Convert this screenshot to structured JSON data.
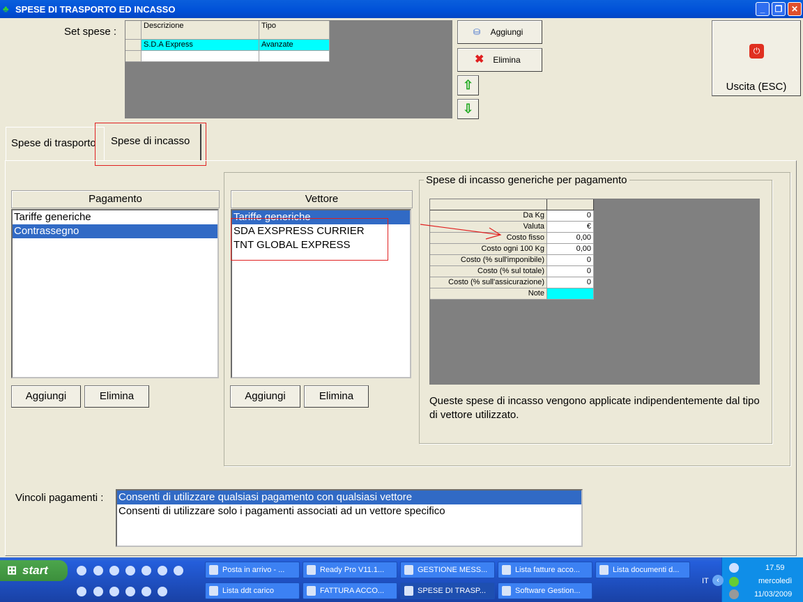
{
  "window": {
    "title": "SPESE DI TRASPORTO ED INCASSO",
    "minimize": "_",
    "restore": "❐",
    "close": "✕"
  },
  "set_spese": {
    "label": "Set spese :",
    "columns": [
      "Descrizione",
      "Tipo"
    ],
    "rows": [
      {
        "descrizione": "S.D.A Express",
        "tipo": "Avanzate"
      }
    ]
  },
  "toolbar": {
    "add": "Aggiungi",
    "delete": "Elimina",
    "up": "⇧",
    "down": "⇩",
    "exit": "Uscita (ESC)"
  },
  "tabs": [
    {
      "label": "Spese di trasporto"
    },
    {
      "label": "Spese di incasso"
    }
  ],
  "pagamento": {
    "header": "Pagamento",
    "items": [
      "Tariffe generiche",
      "Contrassegno"
    ],
    "selected": 1,
    "add": "Aggiungi",
    "delete": "Elimina"
  },
  "vettore": {
    "header": "Vettore",
    "items": [
      "Tariffe generiche",
      "SDA EXSPRESS CURRIER",
      "TNT GLOBAL EXPRESS"
    ],
    "selected": 0,
    "add": "Aggiungi",
    "delete": "Elimina"
  },
  "generiche": {
    "title": "Spese di incasso generiche per pagamento",
    "rows": [
      {
        "label": "Da Kg",
        "value": "0"
      },
      {
        "label": "Valuta",
        "value": "€"
      },
      {
        "label": "Costo fisso",
        "value": "0,00"
      },
      {
        "label": "Costo ogni 100 Kg",
        "value": "0,00"
      },
      {
        "label": "Costo (% sull'imponibile)",
        "value": "0"
      },
      {
        "label": "Costo (% sul totale)",
        "value": "0"
      },
      {
        "label": "Costo (% sull'assicurazione)",
        "value": "0"
      },
      {
        "label": "Note",
        "value": ""
      }
    ],
    "note": "Queste spese di incasso vengono applicate indipendentemente dal tipo di vettore utilizzato."
  },
  "vincoli": {
    "label": "Vincoli pagamenti :",
    "items": [
      "Consenti di utilizzare qualsiasi pagamento con qualsiasi vettore",
      "Consenti di utilizzare solo i pagamenti associati ad un vettore specifico"
    ],
    "selected": 0
  },
  "taskbar": {
    "start": "start",
    "row1": [
      "Posta in arrivo - ...",
      "Ready Pro V11.1...",
      "GESTIONE MESS...",
      "Lista fatture acco...",
      "Lista documenti d..."
    ],
    "row2": [
      "Lista ddt carico",
      "FATTURA ACCO...",
      "SPESE DI TRASP...",
      "Software Gestion..."
    ],
    "lang": "IT",
    "time": "17.59",
    "day": "mercoledì",
    "date": "11/03/2009"
  },
  "colors": {
    "accent": "#316ac5",
    "cyan": "#00ffff",
    "annotation": "#e02020"
  }
}
